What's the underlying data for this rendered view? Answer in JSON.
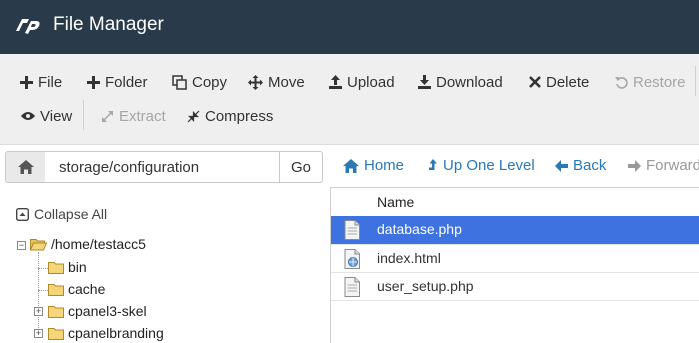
{
  "header": {
    "title": "File Manager",
    "logo_icon": "cpanel-logo-icon"
  },
  "toolbar": {
    "file": "File",
    "folder": "Folder",
    "copy": "Copy",
    "move": "Move",
    "upload": "Upload",
    "download": "Download",
    "delete": "Delete",
    "restore": "Restore",
    "view": "View",
    "extract": "Extract",
    "compress": "Compress"
  },
  "pathbar": {
    "value": "storage/configuration",
    "go": "Go"
  },
  "nav": {
    "home": "Home",
    "up": "Up One Level",
    "back": "Back",
    "forward": "Forward"
  },
  "tree": {
    "collapse_all": "Collapse All",
    "root": "/home/testacc5",
    "children": [
      "bin",
      "cache",
      "cpanel3-skel",
      "cpanelbranding"
    ]
  },
  "files": {
    "column_name": "Name",
    "rows": [
      {
        "name": "database.php",
        "icon": "php-file-icon",
        "selected": true
      },
      {
        "name": "index.html",
        "icon": "html-file-icon",
        "selected": false
      },
      {
        "name": "user_setup.php",
        "icon": "php-file-icon",
        "selected": false
      }
    ]
  },
  "colors": {
    "header_bg": "#293a4a",
    "selection": "#3d72e0",
    "link": "#2a79b7"
  }
}
